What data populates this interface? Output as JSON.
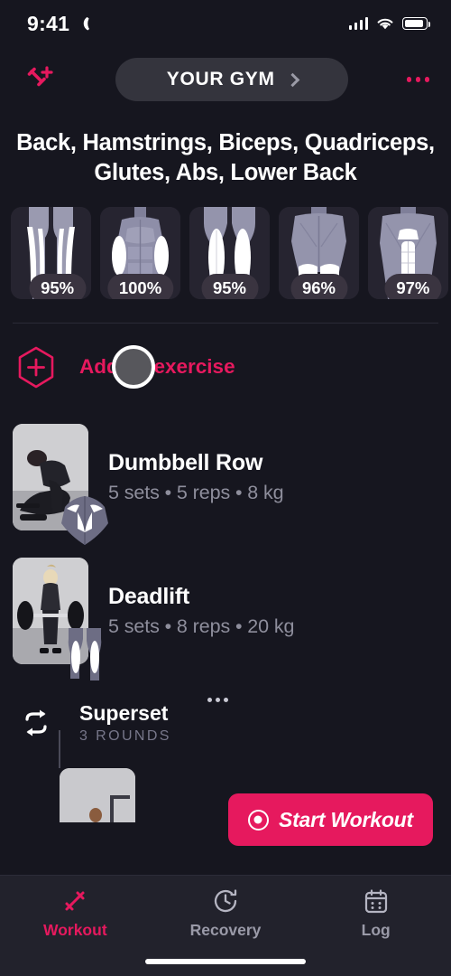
{
  "accent": "#e6195e",
  "background": "#16161f",
  "statusbar": {
    "time": "9:41",
    "moon_icon": "crescent-moon-icon",
    "signal_icon": "cellular-signal-icon",
    "wifi_icon": "wifi-icon",
    "battery_icon": "battery-icon"
  },
  "navbar": {
    "left_icon": "add-dumbbell-icon",
    "gym_label": "YOUR GYM",
    "chevron_icon": "chevron-right-icon",
    "more_icon": "more-options-icon"
  },
  "header": {
    "muscle_groups_title": "Back, Hamstrings, Biceps, Quadriceps, Glutes, Abs, Lower Back"
  },
  "muscles": [
    {
      "name": "Hamstrings",
      "percent": "95%",
      "view": "back-legs"
    },
    {
      "name": "Biceps",
      "percent": "100%",
      "view": "front-arms"
    },
    {
      "name": "Quadriceps",
      "percent": "95%",
      "view": "front-legs"
    },
    {
      "name": "Glutes",
      "percent": "96%",
      "view": "back-glutes"
    },
    {
      "name": "Lower Back",
      "percent": "97%",
      "view": "back-spine"
    }
  ],
  "add_exercise": {
    "label": "Add an exercise",
    "icon": "hexagon-plus-icon",
    "cursor": "mouse-cursor-overlay"
  },
  "exercises": [
    {
      "name": "Dumbbell Row",
      "meta": "5 sets • 5 reps • 8 kg",
      "thumbnail": "dumbbell-row-photo",
      "anatomy": "back-muscles-diagram"
    },
    {
      "name": "Deadlift",
      "meta": "5 sets • 8 reps • 20 kg",
      "thumbnail": "deadlift-photo",
      "anatomy": "legs-muscles-diagram"
    }
  ],
  "superset": {
    "title": "Superset",
    "rounds": "3 ROUNDS",
    "icon": "repeat-icon",
    "more_icon": "more-options-icon"
  },
  "start_button": {
    "label": "Start Workout",
    "icon": "record-circle-icon"
  },
  "tabs": [
    {
      "label": "Workout",
      "icon": "dumbbell-icon",
      "active": true
    },
    {
      "label": "Recovery",
      "icon": "clock-refresh-icon",
      "active": false
    },
    {
      "label": "Log",
      "icon": "calendar-icon",
      "active": false
    }
  ]
}
